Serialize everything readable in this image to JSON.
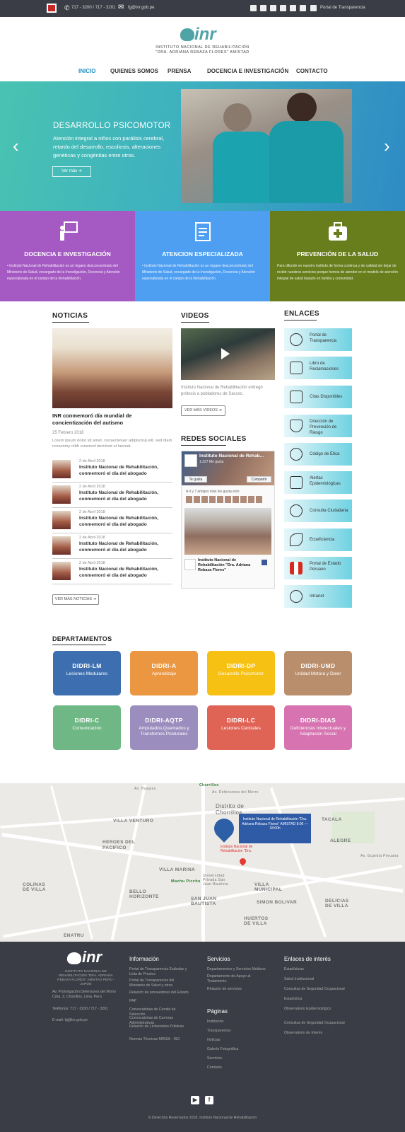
{
  "topbar": {
    "phone": "717 - 3200 / 717 - 3201",
    "email": "fg@inr.gob.pe",
    "transparency": "Portal de Transparencia"
  },
  "header": {
    "logo_text": "inr",
    "subtitle_1": "INSTITUTO NACIONAL DE REHABILITACIÓN",
    "subtitle_2": "\"DRA. ADRIANA REBAZA FLORES\" AMISTAD"
  },
  "nav": [
    "INICIO",
    "QUIENES SOMOS",
    "PRENSA",
    "DOCENCIA E INVESTIGACIÓN",
    "CONTACTO"
  ],
  "hero": {
    "title": "DESARROLLO PSICOMOTOR",
    "text": "Atención integral a niños con parálisis cerebral, retardo del desarrollo, escoliosis, alteraciones genéticas y congénitas entre otros.",
    "button": "Ver más  ➔"
  },
  "services": [
    {
      "title": "DOCENCIA E INVESTIGACIÓN",
      "text": "• Instituto Nacional de Rehabilitación es un órgano desconcentrado del Ministerio de Salud, encargado de la Investigación, Docencia y Atención especializada en el campo de la Rehabilitación.",
      "color": "#a55ac3"
    },
    {
      "title": "ATENCION ESPECIALIZADA",
      "text": "• Instituto Nacional de Rehabilitación es un órgano desconcentrado del Ministerio de Salud, encargado de la Investigación, Docencia y Atención especializada en el campo de la Rehabilitación.",
      "color": "#4e9ff2"
    },
    {
      "title": "PREVENCIÓN DE LA SALUD",
      "text": "Para difundir en nuestro instituto de forma continua y de calidad sin dejar de recibir nuestros servicios porque hemos de atender en el modelo de atención integral de salud basado en familia y comunidad.",
      "color": "#687d1b"
    }
  ],
  "news": {
    "title": "NOTICIAS",
    "headline": "INR conmemoró día mundial de concientización del autismo",
    "date": "25 Febrero 2018",
    "lorem": "Lorem ipsum dolor sit amet, consectetuer adipiscing elit, sed diam nonummy nibh euismod tincidunt ut laoreet.",
    "items": [
      {
        "date": "2 de Abril 2018",
        "text": "Instituto Nacional de Rehabilitación, conmemoró el día del abogado"
      },
      {
        "date": "2 de Abril 2018",
        "text": "Instituto Nacional de Rehabilitación, conmemoró el día del abogado"
      },
      {
        "date": "2 de Abril 2018",
        "text": "Instituto Nacional de Rehabilitación, conmemoró el día del abogado"
      },
      {
        "date": "2 de Abril 2018",
        "text": "Instituto Nacional de Rehabilitación, conmemoró el día del abogado"
      },
      {
        "date": "2 de Abril 2018",
        "text": "Instituto Nacional de Rehabilitación, conmemoró el día del abogado"
      }
    ],
    "more": "VER MÁS NOTICIAS  ➔"
  },
  "videos": {
    "title": "VIDEOS",
    "desc": "Instituto Nacional de Rehabilitación entregó prótesis a pobladores de Sacsoc.",
    "more": "VER MÁS VIDEOS  ➔"
  },
  "social": {
    "title": "REDES SOCIALES",
    "fb_name": "Instituto Nacional de Rehab...",
    "fb_likes": "1.327 Me gusta",
    "fb_like_btn": "Te gusta",
    "fb_share_btn": "Compartir",
    "fb_post": "A ti y 7 amigos más les gusta esto",
    "fb_page": "Instituto Nacional de Rehabilitación \"Dra. Adriana Rebaza Flores\""
  },
  "links": {
    "title": "ENLACES",
    "items": [
      "Portal de Transparencia",
      "Libro de Reclamaciones",
      "Citas Disponibles",
      "Dirección de Prevención de Riesgo",
      "Código de Ética",
      "Alertas Epidemiológicas",
      "Consulta Ciudadana",
      "Ecoeficiencia",
      "Portal de Estado Peruano",
      "Intranet"
    ]
  },
  "departments": {
    "title": "DEPARTAMENTOS",
    "items": [
      {
        "code": "DIDRI-LM",
        "name": "Lesiones Medulares",
        "color": "#3d6fb0"
      },
      {
        "code": "DIDRI-A",
        "name": "Aprendizaje",
        "color": "#eb9741"
      },
      {
        "code": "DIDRI-DP",
        "name": "Desarrollo Psicomotor",
        "color": "#f6c113"
      },
      {
        "code": "DIDRI-UMD",
        "name": "Unidad Motora y Dolor",
        "color": "#b98e6c"
      },
      {
        "code": "DIDRI-C",
        "name": "Comunicación",
        "color": "#6fb784"
      },
      {
        "code": "DIDRI-AQTP",
        "name": "Amputados,Quemados y Transtornos Posturales",
        "color": "#9b8ebf"
      },
      {
        "code": "DIDRI-LC",
        "name": "Lesiones Centrales",
        "color": "#e06456"
      },
      {
        "code": "DIDRI-DIAS",
        "name": "Deficiencias Intelectuales y Adaptación Social",
        "color": "#d673b0"
      }
    ]
  },
  "map": {
    "box_text": "Instituto Nacional de Rehabilitación \"Dra. Adriana Rebaza Flores\" AMISTAD 8:00 — 18:00h",
    "pin_label": "Instituto Nacional de Rehabilitación \"Dra.",
    "labels": [
      "VILLA VENTURO",
      "HEROES DEL PACIFICO",
      "Distrito de Chorrillos",
      "TACALA",
      "ALEGRE",
      "VILLA MARINA",
      "Machu Picchu",
      "Universidad Privada San Juan Bautista",
      "SAN JUAN BAUTISTA",
      "VILLA MUNICIPAL",
      "COLINAS DE VILLA",
      "BELLO HORIZONTE",
      "SIMON BOLIVAR",
      "DELICIAS DE VILLA",
      "HUERTOS DE VILLA",
      "ENATRU",
      "Av. Defensores del Morro",
      "Av. Huaylas",
      "Av. Guardia Peruana",
      "Chorrillos"
    ]
  },
  "footer": {
    "logo_text": "inr",
    "inst_name": "INSTITUTO NACIONAL DE REHABILITACIÓN \"DRA. ADRIANA REBAZA FLORES\" AMISTAD PERÚ - JAPÓN",
    "address": "Av. Prolongación Defensores del Morro Cdra. 2, Chorrillos, Lima, Perú",
    "phone": "Teléfonos: 717 - 3200 / 717 - 3201",
    "email": "E-mail: fg@inr.gob.pe",
    "col1_title": "Información",
    "col1": [
      "Portal de Transparencia Estándar y Lista de Precios",
      "Portal de Transparencia del Ministerio de Salud y otros",
      "Relación de proveedores del Estado",
      "PAP",
      "Convocatorias de Comité de Selección",
      "Convocatorias de Carreras Administrativas",
      "Relación de Licitaciones Públicas",
      "Normas Técnicas MINSA - ISO"
    ],
    "col2_title": "Servicios",
    "col2": [
      "Departamentos y Servicios Médicos",
      "Departamento de Apoyo al Tratamiento",
      "Relación de servicios"
    ],
    "col3_title": "Páginas",
    "col3": [
      "Institución",
      "Transparencia",
      "Noticias",
      "Galería Fotográfica",
      "Servicios",
      "Contacto"
    ],
    "col4_title": "Enlaces de interés",
    "col4": [
      "Estadísticas",
      "Salud Institucional",
      "Consultas de Seguridad Ocupacional",
      "Estadística",
      "Observatorio Epidemiológico",
      "Consultas de Seguridad Ocupacional",
      "Observatorio de Interés"
    ],
    "copyright": "© Derechos Reservados 2018. Instituto Nacional de Rehabilitación"
  }
}
